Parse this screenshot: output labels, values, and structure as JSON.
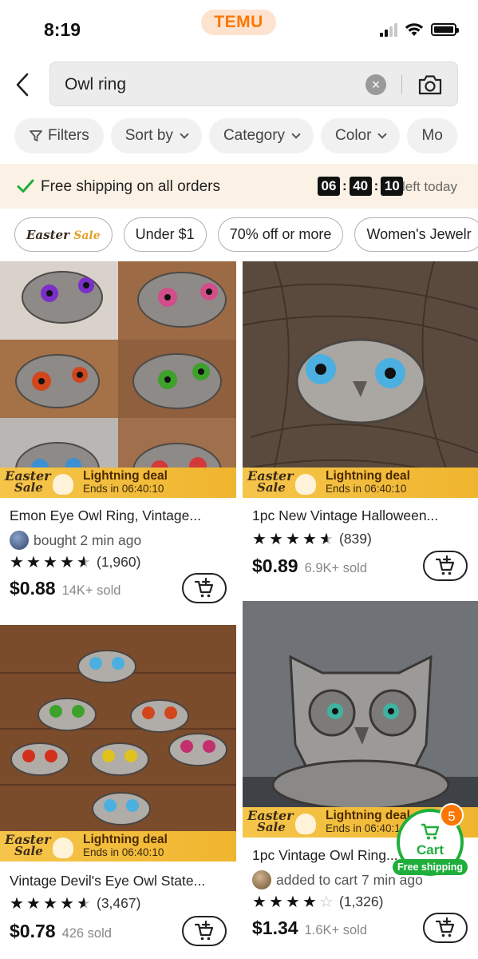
{
  "status_bar": {
    "time": "8:19",
    "brand": "TEMU"
  },
  "search": {
    "query": "Owl ring",
    "clear_label": "×"
  },
  "filters": [
    {
      "label": "Filters",
      "icon": "funnel-icon"
    },
    {
      "label": "Sort by",
      "icon": "chevron-down-icon"
    },
    {
      "label": "Category",
      "icon": "chevron-down-icon"
    },
    {
      "label": "Color",
      "icon": "chevron-down-icon"
    },
    {
      "label": "Mo",
      "icon": ""
    }
  ],
  "shipping_banner": {
    "text": "Free shipping on all orders",
    "timer": {
      "hours": "06",
      "minutes": "40",
      "seconds": "10"
    },
    "timer_label": "left today",
    "sep": ":"
  },
  "quick_tags": [
    {
      "label": "Easter",
      "sub": "Sale"
    },
    {
      "label": "Under $1"
    },
    {
      "label": "70% off or more"
    },
    {
      "label": "Women's Jewelr"
    }
  ],
  "deal_badge": {
    "logo_top": "Easter",
    "logo_bottom": "Sale",
    "title": "Lightning deal",
    "subtitle": "Ends in 06:40:10"
  },
  "products": [
    {
      "title": "Emon Eye Owl Ring, Vintage...",
      "activity": "bought 2 min ago",
      "rating": 4.5,
      "rating_count": "(1,960)",
      "price": "$0.88",
      "sold": "14K+ sold"
    },
    {
      "title": "1pc New Vintage Halloween...",
      "activity": "",
      "rating": 4.5,
      "rating_count": "(839)",
      "price": "$0.89",
      "sold": "6.9K+ sold"
    },
    {
      "title": "Vintage Devil's Eye Owl State...",
      "activity": "",
      "rating": 4.5,
      "rating_count": "(3,467)",
      "price": "$0.78",
      "sold": "426 sold"
    },
    {
      "title": "1pc Vintage Owl Ring...",
      "activity": "added to cart 7 min ago",
      "rating": 4,
      "rating_count": "(1,326)",
      "price": "$1.34",
      "sold": "1.6K+ sold"
    }
  ],
  "floating_cart": {
    "label": "Cart",
    "count": "5",
    "free_shipping": "Free shipping"
  },
  "colors": {
    "accent": "#fb7701",
    "deal": "#f0b52f",
    "green": "#1fae3b"
  }
}
